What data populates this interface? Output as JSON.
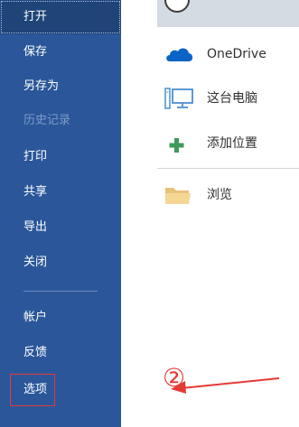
{
  "sidebar": {
    "items": [
      {
        "label": "打开",
        "state": "selected"
      },
      {
        "label": "保存",
        "state": "normal"
      },
      {
        "label": "另存为",
        "state": "normal"
      },
      {
        "label": "历史记录",
        "state": "disabled"
      },
      {
        "label": "打印",
        "state": "normal"
      },
      {
        "label": "共享",
        "state": "normal"
      },
      {
        "label": "导出",
        "state": "normal"
      },
      {
        "label": "关闭",
        "state": "normal"
      },
      {
        "label": "帐户",
        "state": "normal"
      },
      {
        "label": "反馈",
        "state": "normal"
      },
      {
        "label": "选项",
        "state": "highlighted"
      }
    ],
    "background_color": "#2b579a"
  },
  "locations": {
    "items": [
      {
        "label": "OneDrive",
        "icon": "onedrive-cloud-icon"
      },
      {
        "label": "这台电脑",
        "icon": "computer-icon"
      },
      {
        "label": "添加位置",
        "icon": "add-plus-icon"
      },
      {
        "label": "浏览",
        "icon": "folder-icon"
      }
    ]
  },
  "annotation": {
    "marker": "②",
    "color": "#e53935"
  }
}
